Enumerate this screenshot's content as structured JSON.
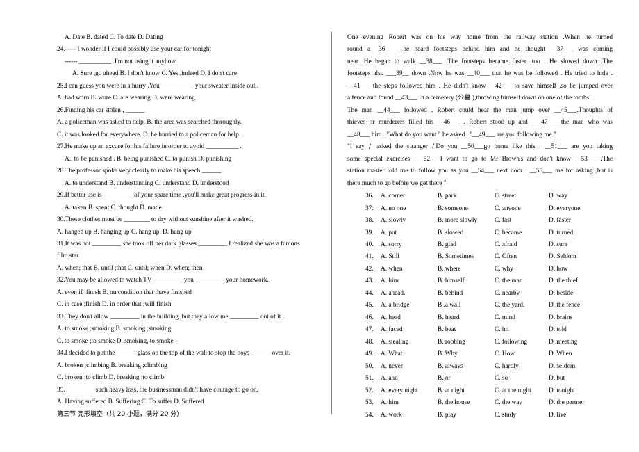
{
  "document": {
    "type": "english-exam-paper",
    "columns": 2
  },
  "left_column": {
    "lines": [
      {
        "indent": 1,
        "text": "A. Date                B. dated           C. To date        D. Dating"
      },
      {
        "indent": 0,
        "text": "24.----- I wonder if I could possibly use your car for tonight"
      },
      {
        "indent": 1,
        "text": "------ __________ .I'm not using it anyhow."
      },
      {
        "indent": 2,
        "text": "A.  Sure ,go ahead    B. I don't know    C. Yes ,indeed   D. I don't care"
      },
      {
        "indent": 0,
        "text": "25.I can guess you were in a hurry .You __________ your sweater inside out ."
      },
      {
        "indent": 0,
        "text": "A. had worn      B. wore     C. are wearing     D. were wearing"
      },
      {
        "indent": 0,
        "text": "26.Finding his car stolen , ______"
      },
      {
        "indent": 0,
        "text": "A. a policeman was asked to help.      B. the area was searched thoroughly."
      },
      {
        "indent": 0,
        "text": "C. it was looked for everywhere.       D. he hurried to a policeman for help."
      },
      {
        "indent": 0,
        "text": "27.He make up an excuse for his failure in order to avoid __________ ."
      },
      {
        "indent": 1,
        "text": "A.. to be punished .    B. being punished    C. to punish    D. punishing"
      },
      {
        "indent": 0,
        "text": "28.The professor spoke very clearly to make his speech ______."
      },
      {
        "indent": 1,
        "text": "A. to understand    B. understanding    C. understand    D. understood"
      },
      {
        "indent": 0,
        "text": "29.If better use is _________ of your spare time ,you'll make great progress in it."
      },
      {
        "indent": 1,
        "text": "A. taken                B. spent               C. thought          D. made"
      },
      {
        "indent": 0,
        "text": "30.These clothes must be ________ to dry without sunshine after it washed."
      },
      {
        "indent": 0,
        "text": "A. hanged up    B. hanging up    C. hang up.      D. hung up"
      },
      {
        "indent": 0,
        "text": "31.It was not _________ she took off her dark glasses _________ I realized she was a famous"
      },
      {
        "indent": 0,
        "text": "film star."
      },
      {
        "indent": 0,
        "text": "A. when; that     B. until ;that     C. until; when     D. when; then"
      },
      {
        "indent": 0,
        "text": "32.You may be allowed to watch TV _________ you _________ your homework."
      },
      {
        "indent": 0,
        "text": "A. even if ;finish             B. on condition that ;have finished"
      },
      {
        "indent": 0,
        "text": "C. in case ;finish           D. in order that ;will finish"
      },
      {
        "indent": 0,
        "text": "33.They don't allow _________ in the building ,but they allow me _________ out of it ."
      },
      {
        "indent": 0,
        "text": "A. to smoke ;smoking          B. smoking ;smoking"
      },
      {
        "indent": 0,
        "text": "C. to smoke ;to smoke         D. smoking, to smoke"
      },
      {
        "indent": 0,
        "text": "34.I decided to put the ______ glass on the top of the wall to stop the boys ______ over it."
      },
      {
        "indent": 0,
        "text": "A. broken ;climbing             B. breaking ;climbing"
      },
      {
        "indent": 0,
        "text": "C. broken ;to climb             D. breaking ;to climb"
      },
      {
        "indent": 0,
        "text": "35._________ such heavy loss, the businessman didn't have courage to go on."
      },
      {
        "indent": 0,
        "text": "A. Having   suffered   B. Suffering   C. To suffer      D. Suffered"
      },
      {
        "indent": 0,
        "text": "第三节   完形填空（共 20 小题，满分 20 分）",
        "chinese": true
      }
    ]
  },
  "right_column": {
    "passage": {
      "paragraphs": [
        {
          "lines": [
            "    One evening Robert was on his way home from the railway station .When he turned",
            "round a _36____ he heard footsteps behind him and he thought    __37___ was coming",
            "near .He began to walk __38___ .The footsteps became faster ,too . He slowed down .The",
            "footsteps also ___39__ down .Now he was __40___ that he was be followed . He tried to hide .",
            "__41___ the steps followed him . He didn't know __42___ to save himself ,so he jumped over",
            "a fence and found __43___ in a cemetery (公墓 ),throwing himself down on one of the tombs."
          ]
        },
        {
          "lines": [
            "    The man __44___ followed . Robert could hear the man jump over __45___.Thoughts of",
            "thieves or murderers filled his __46___ .   Robert stood up and ___47___ the man who was",
            "__48___ him . \"What do you want \" he asked . \"__49___ are you following me \""
          ]
        },
        {
          "lines": [
            "    \"I say ,\" asked the stranger .\"Do you __50___go home like this , __51___ are you taking",
            "some special exercises ___52__   I want to go to Mr Brown's and don't know __53___ .The",
            "station master told me to follow you as you __54___ next door . __55___ me for asking ,but is",
            "there much to go before we get there \""
          ]
        }
      ]
    },
    "cloze_options": [
      {
        "num": "36.",
        "a": "A. corner",
        "b": "B. park",
        "c": "C. street",
        "d": "D. way"
      },
      {
        "num": "37.",
        "a": "A. no one",
        "b": "B. someone",
        "c": "C. anyone",
        "d": "D. everyone"
      },
      {
        "num": "38.",
        "a": "A. slowly",
        "b": "B. more slowly",
        "c": "C. fast",
        "d": "D. faster"
      },
      {
        "num": "39.",
        "a": "A. put",
        "b": "B .slowed",
        "c": "C. became",
        "d": "D .turned"
      },
      {
        "num": "40.",
        "a": "A. sorry",
        "b": "B. glad",
        "c": "C. afraid",
        "d": "D. sure"
      },
      {
        "num": "41.",
        "a": "A. Still",
        "b": "B. Sometimes",
        "c": "C. Often",
        "d": "D. Seldom"
      },
      {
        "num": "42.",
        "a": "A. when",
        "b": "B. where",
        "c": "C. why",
        "d": "D. how"
      },
      {
        "num": "43.",
        "a": "A. him",
        "b": "B. himself",
        "c": "C. the man",
        "d": "D. the thief"
      },
      {
        "num": "44.",
        "a": "A. ahead.",
        "b": "B. behind",
        "c": "C. nearby",
        "d": "D. beside"
      },
      {
        "num": "45.",
        "a": "A. a bridge",
        "b": "B .a wall",
        "c": "C. the yard.",
        "d": "D .the fence"
      },
      {
        "num": "46.",
        "a": "A. head",
        "b": "B. heard",
        "c": "C. mind",
        "d": "D. brains"
      },
      {
        "num": "47.",
        "a": "A. faced",
        "b": "B. beat",
        "c": "C. hit",
        "d": "D. told"
      },
      {
        "num": "48.",
        "a": "A. stealing",
        "b": "B. robbing",
        "c": "C. following",
        "d": "D .meeting"
      },
      {
        "num": "49.",
        "a": "A. What",
        "b": "B. Why",
        "c": "C. How",
        "d": "D. When"
      },
      {
        "num": "50.",
        "a": "A. never",
        "b": "B. always",
        "c": "C. hardly",
        "d": "D. seldom"
      },
      {
        "num": "51.",
        "a": "A. and",
        "b": "B. or",
        "c": "C. so",
        "d": "D. but"
      },
      {
        "num": "52.",
        "a": "A. every night",
        "b": "B. at night",
        "c": "C. at the night",
        "d": "D. tonight"
      },
      {
        "num": "53.",
        "a": "A. him",
        "b": "B. the house",
        "c": "C. the way",
        "d": "D. the partner"
      },
      {
        "num": "54.",
        "a": "A. work",
        "b": "B. play",
        "c": "C. study",
        "d": "D. live"
      }
    ]
  },
  "colors": {
    "text": "#000000",
    "background": "#ffffff",
    "divider": "#808080"
  }
}
